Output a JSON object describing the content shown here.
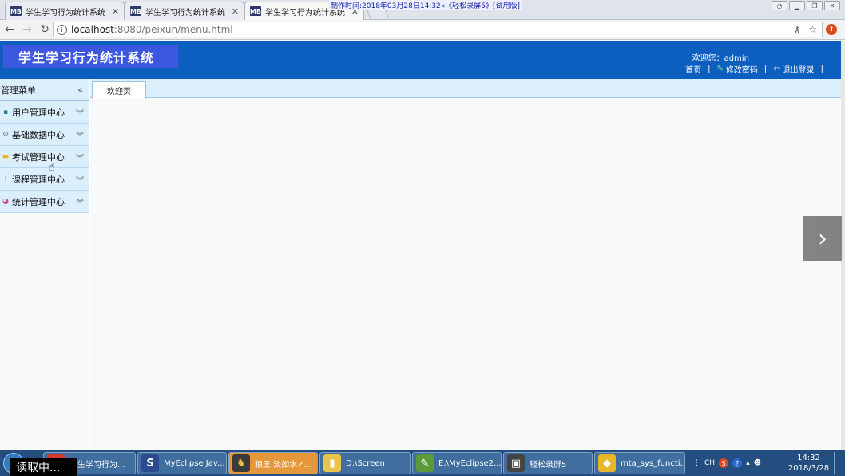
{
  "browser": {
    "tabs": [
      {
        "favicon": "MB",
        "title": "学生学习行为统计系统"
      },
      {
        "favicon": "MB",
        "title": "学生学习行为统计系统"
      },
      {
        "favicon": "MB",
        "title": "学生学习行为统计系统"
      }
    ],
    "watermark": "制作时间:2018年03月28日14:32«《轻松录屏5》[试用版]",
    "url_host": "localhost",
    "url_path": ":8080/peixun/menu.html"
  },
  "app": {
    "title": "学生学习行为统计系统",
    "welcome": "欢迎您：admin",
    "links": {
      "home": "首页",
      "change_password": "修改密码",
      "logout": "退出登录"
    }
  },
  "sidebar": {
    "title": "管理菜单",
    "items": [
      {
        "label": "用户管理中心",
        "icon": "user-icon"
      },
      {
        "label": "基础数据中心",
        "icon": "gear-icon"
      },
      {
        "label": "考试管理中心",
        "icon": "folder-icon"
      },
      {
        "label": "课程管理中心",
        "icon": "grid-icon"
      },
      {
        "label": "统计管理中心",
        "icon": "pie-chart-icon"
      }
    ]
  },
  "main": {
    "tab_label": "欢迎页"
  },
  "taskbar": {
    "loading_text": "读取中...",
    "tasks": [
      {
        "label": "学生学习行为..."
      },
      {
        "label": "MyEclipse Jav..."
      },
      {
        "label": "狼王·淡如水✓..."
      },
      {
        "label": "D:\\Screen"
      },
      {
        "label": "E:\\MyEclipse2..."
      },
      {
        "label": "轻松录屏5"
      },
      {
        "label": "mta_sys_functi..."
      }
    ],
    "tray_lang": "CH",
    "clock_time": "14:32",
    "clock_date": "2018/3/28"
  },
  "colors": {
    "header": "#0c5fbf",
    "logo": "#3c57e0",
    "sidebar": "#dbeefb"
  }
}
